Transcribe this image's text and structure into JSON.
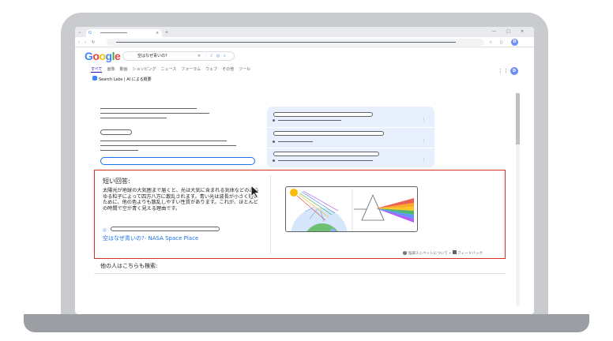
{
  "browser": {
    "window_controls": [
      "—",
      "□",
      "✕"
    ],
    "nav_buttons": [
      "‹",
      "›",
      "↻"
    ],
    "avatar_letter": "D"
  },
  "google": {
    "logo_letters": [
      {
        "ch": "G",
        "color": "#4285f4"
      },
      {
        "ch": "o",
        "color": "#ea4335"
      },
      {
        "ch": "o",
        "color": "#fbbc05"
      },
      {
        "ch": "g",
        "color": "#4285f4"
      },
      {
        "ch": "l",
        "color": "#34a853"
      },
      {
        "ch": "e",
        "color": "#ea4335"
      }
    ],
    "search_query": "空はなぜ青いの?",
    "search_clear": "×",
    "tabs": [
      "すべて",
      "画像",
      "動画",
      "ショッピング",
      "ニュース",
      "フォーラム",
      "ウェブ",
      "その他",
      "ツール"
    ],
    "search_labs": "Search Labs | AI による概要"
  },
  "snippet": {
    "heading": "短い回答:",
    "body": "太陽光が地球の大気圏まで届くと、光は大気に含まれる気体などのあらゆる粒子によって四方八方に散乱されます。青い光は波長が小さく短いために、他の色よりも散乱しやすい性質があります。これが、ほとんどの時間で空が青く見える理由です。",
    "link": "空はなぜ青いの?- NASA Space Place",
    "about": "強調スニペットについて",
    "separator": "•",
    "feedback": "フィードバック"
  },
  "others_search": "他の人はこちらも検索:",
  "colors": {
    "highlight_border": "#d93025",
    "link": "#1a73e8",
    "card_bg": "#e8f0fe",
    "avatar": "#6f8df5"
  }
}
